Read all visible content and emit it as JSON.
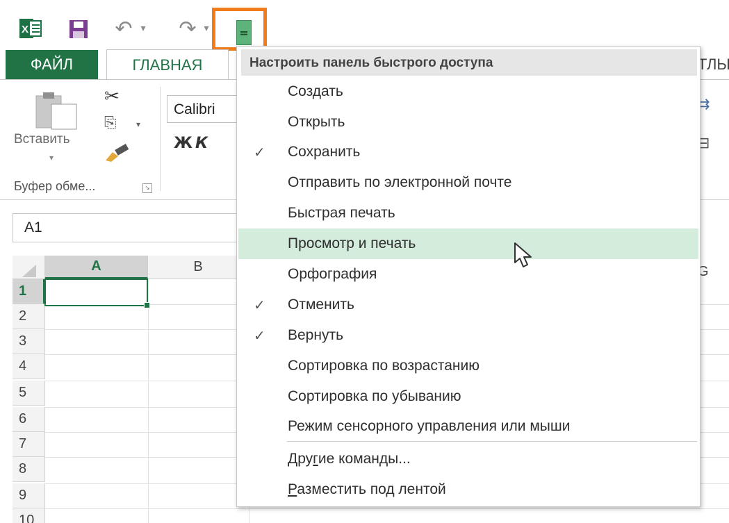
{
  "quick_access": {
    "icons": [
      "excel-logo-icon",
      "save-icon",
      "undo-icon",
      "redo-icon",
      "customize-qat-icon"
    ],
    "highlight_color": "#f07c1b"
  },
  "ribbon": {
    "tab_file": "ФАЙЛ",
    "tab_home": "ГЛАВНАЯ",
    "tab_partial_right": "ТЛЫ",
    "paste_label": "Вставить",
    "clipboard_group": "Буфер обме...",
    "font_name": "Calibri",
    "bold": "Ж",
    "italic": "К",
    "accent_color": "#217346"
  },
  "formula_bar": {
    "name_box": "A1"
  },
  "grid": {
    "columns": [
      "A",
      "B"
    ],
    "partial_column": "G",
    "rows": [
      "1",
      "2",
      "3",
      "4",
      "5",
      "6",
      "7",
      "8",
      "9",
      "10"
    ],
    "selected_cell": "A1"
  },
  "menu": {
    "header": "Настроить панель быстрого доступа",
    "items": [
      {
        "label": "Создать",
        "checked": false
      },
      {
        "label": "Открыть",
        "checked": false
      },
      {
        "label": "Сохранить",
        "checked": true
      },
      {
        "label": "Отправить по электронной почте",
        "checked": false
      },
      {
        "label": "Быстрая печать",
        "checked": false
      },
      {
        "label": "Просмотр и печать",
        "checked": false,
        "hovered": true
      },
      {
        "label": "Орфография",
        "checked": false
      },
      {
        "label": "Отменить",
        "checked": true
      },
      {
        "label": "Вернуть",
        "checked": true
      },
      {
        "label": "Сортировка по возрастанию",
        "checked": false
      },
      {
        "label": "Сортировка по убыванию",
        "checked": false
      },
      {
        "label": "Режим сенсорного управления или мыши",
        "checked": false
      }
    ],
    "more_commands": {
      "prefix": "Дру",
      "underlined": "г",
      "suffix": "ие команды..."
    },
    "show_below": {
      "underlined": "Р",
      "suffix": "азместить под лентой"
    },
    "check_mark": "✓",
    "hover_color": "#d3ecdc"
  }
}
